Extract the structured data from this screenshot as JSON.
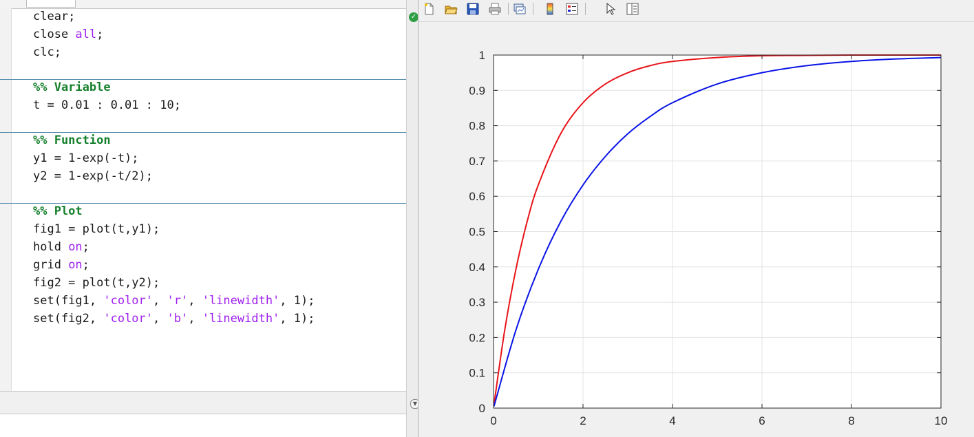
{
  "editor": {
    "lines": {
      "l1": "clear;",
      "l2a": "close ",
      "l2b": "all",
      "l2c": ";",
      "l3": "clc;",
      "l4": "%% Variable",
      "l5": "t = 0.01 : 0.01 : 10;",
      "l6": "%% Function",
      "l7": "y1 = 1-exp(-t);",
      "l8": "y2 = 1-exp(-t/2);",
      "l9": "%% Plot",
      "l10": "fig1 = plot(t,y1);",
      "l11a": "hold ",
      "l11b": "on",
      "l11c": ";",
      "l12a": "grid ",
      "l12b": "on",
      "l12c": ";",
      "l13": "fig2 = plot(t,y2);",
      "l14a": "set(fig1, ",
      "l14b": "'color'",
      "l14c": ", ",
      "l14d": "'r'",
      "l14e": ", ",
      "l14f": "'linewidth'",
      "l14g": ", 1);",
      "l15a": "set(fig2, ",
      "l15b": "'color'",
      "l15c": ", ",
      "l15d": "'b'",
      "l15e": ", ",
      "l15f": "'linewidth'",
      "l15g": ", 1);"
    }
  },
  "figure_toolbar": [
    "new-figure-icon",
    "open-file-icon",
    "save-icon",
    "print-icon",
    "link-plot-icon",
    "colorbar-icon",
    "legend-icon",
    "pointer-icon",
    "property-inspector-icon"
  ],
  "chart_data": {
    "type": "line",
    "title": "",
    "xlabel": "",
    "ylabel": "",
    "xlim": [
      0,
      10
    ],
    "ylim": [
      0,
      1
    ],
    "xticks": [
      "0",
      "2",
      "4",
      "6",
      "8",
      "10"
    ],
    "yticks": [
      "0",
      "0.1",
      "0.2",
      "0.3",
      "0.4",
      "0.5",
      "0.6",
      "0.7",
      "0.8",
      "0.9",
      "1"
    ],
    "grid": true,
    "series": [
      {
        "color": "#e8141a",
        "x": [
          0.01,
          0.25,
          0.5,
          0.75,
          1,
          1.5,
          2,
          2.5,
          3,
          3.5,
          4,
          5,
          6,
          7,
          8,
          9,
          10
        ],
        "y": [
          0.01,
          0.221,
          0.393,
          0.528,
          0.632,
          0.777,
          0.865,
          0.918,
          0.95,
          0.97,
          0.982,
          0.993,
          0.998,
          0.999,
          1.0,
          1.0,
          1.0
        ]
      },
      {
        "color": "#0a14e6",
        "x": [
          0.01,
          0.5,
          1,
          1.5,
          2,
          2.5,
          3,
          3.5,
          4,
          5,
          6,
          7,
          8,
          9,
          10
        ],
        "y": [
          0.005,
          0.221,
          0.393,
          0.528,
          0.632,
          0.713,
          0.777,
          0.826,
          0.865,
          0.918,
          0.95,
          0.97,
          0.982,
          0.989,
          0.993
        ]
      }
    ]
  }
}
